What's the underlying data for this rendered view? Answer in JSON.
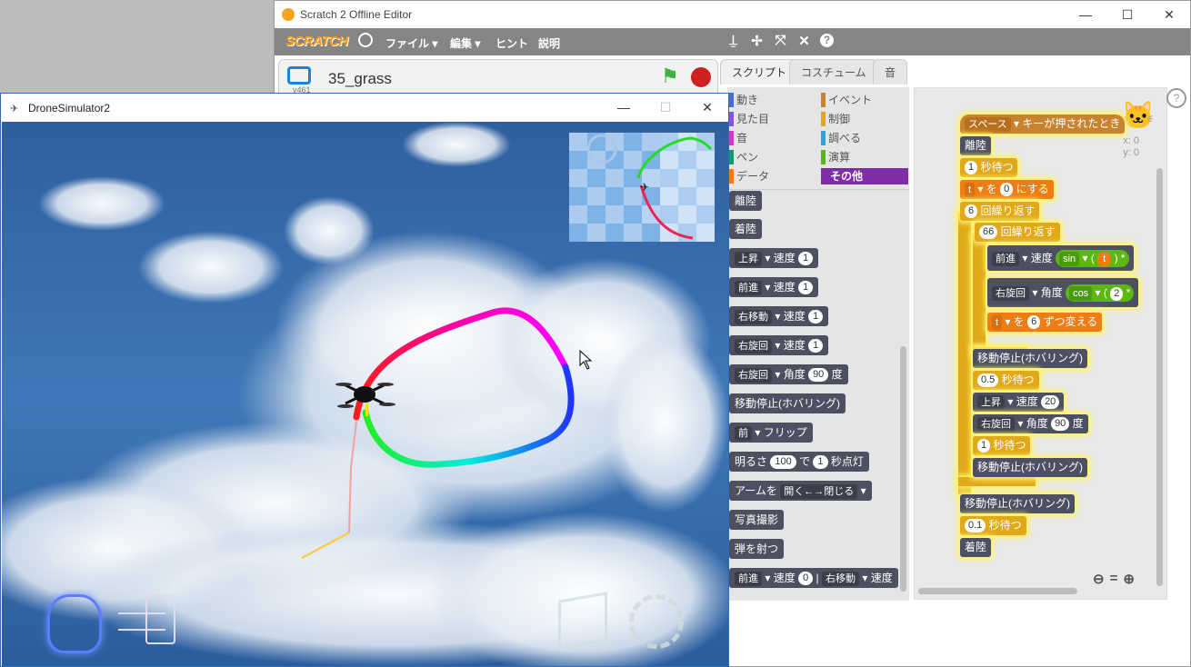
{
  "scratch": {
    "window_title": "Scratch 2 Offline Editor",
    "window_controls": {
      "minimize": "—",
      "maximize": "☐",
      "close": "✕"
    },
    "logo": "SCRATCH",
    "menu": [
      "ファイル ▾",
      "編集 ▾",
      "ヒント",
      "説明"
    ],
    "tool_icons": [
      "copy-tool-icon",
      "cut-tool-icon",
      "grow-tool-icon",
      "shrink-tool-icon",
      "help-tool-icon"
    ],
    "project_name": "35_grass",
    "version": "v461",
    "tabs": [
      "スクリプト",
      "コスチューム",
      "音"
    ],
    "categories_left": [
      {
        "label": "動き",
        "color": "#4a6cd4"
      },
      {
        "label": "見た目",
        "color": "#8a55d7"
      },
      {
        "label": "音",
        "color": "#bb42c3"
      },
      {
        "label": "ペン",
        "color": "#0e9a6c"
      },
      {
        "label": "データ",
        "color": "#ee7d16"
      }
    ],
    "categories_right": [
      {
        "label": "イベント",
        "color": "#c88330"
      },
      {
        "label": "制御",
        "color": "#e1a91a"
      },
      {
        "label": "調べる",
        "color": "#2ca5e2"
      },
      {
        "label": "演算",
        "color": "#5cb712"
      },
      {
        "label": "その他",
        "color": "#7f2ca7"
      }
    ],
    "palette_blocks": [
      {
        "text": "離陸"
      },
      {
        "text": "着陸"
      },
      {
        "dd": "上昇",
        "label": "速度",
        "num": "1"
      },
      {
        "dd": "前進",
        "label": "速度",
        "num": "1"
      },
      {
        "dd": "右移動",
        "label": "速度",
        "num": "1"
      },
      {
        "dd": "右旋回",
        "label": "速度",
        "num": "1"
      },
      {
        "dd": "右旋回",
        "label": "角度",
        "num": "90",
        "suffix": "度"
      },
      {
        "text": "移動停止(ホバリング)"
      },
      {
        "dd": "前",
        "label": "フリップ"
      },
      {
        "pre": "明るさ",
        "num": "100",
        "mid": "で",
        "num2": "1",
        "suffix": "秒点灯"
      },
      {
        "pre": "アームを",
        "dd": "開く←→閉じる"
      },
      {
        "text": "写真撮影"
      },
      {
        "text": "弾を射つ"
      },
      {
        "dd": "前進",
        "label": "速度",
        "num": "0",
        "mid": "| ",
        "dd2": "右移動",
        "label2": "速度"
      }
    ],
    "script": {
      "hat": {
        "dd": "スペース",
        "label": "キーが押されたとき"
      },
      "takeoff": "離陸",
      "wait1": {
        "num": "1",
        "label": "秒待つ"
      },
      "setvar": {
        "dd": "t",
        "label": "を",
        "num": "0",
        "suffix": "にする"
      },
      "repeat_outer": {
        "num": "6",
        "label": "回繰り返す"
      },
      "repeat_inner": {
        "num": "66",
        "label": "回繰り返す"
      },
      "forward": {
        "dd": "前進",
        "label": "速度",
        "fn": "sin",
        "var": "t",
        "tail": ") *"
      },
      "rotate": {
        "dd": "右旋回",
        "label": "角度",
        "fn": "cos",
        "num": "2",
        "tail": "*"
      },
      "change": {
        "dd": "t",
        "label": "を",
        "num": "6",
        "suffix": "ずつ変える"
      },
      "hover1": "移動停止(ホバリング)",
      "wait2": {
        "num": "0.5",
        "label": "秒待つ"
      },
      "up": {
        "dd": "上昇",
        "label": "速度",
        "num": "20"
      },
      "turn": {
        "dd": "右旋回",
        "label": "角度",
        "num": "90",
        "suffix": "度"
      },
      "wait3": {
        "num": "1",
        "label": "秒待つ"
      },
      "hover2": "移動停止(ホバリング)",
      "hover3": "移動停止(ホバリング)",
      "wait4": {
        "num": "0.1",
        "label": "秒待つ"
      },
      "land": "着陸"
    },
    "sprite_coords": {
      "x": "x: 0",
      "y": "y: 0"
    },
    "zoom_controls": [
      "zoom-out-icon",
      "zoom-reset-icon",
      "zoom-in-icon"
    ]
  },
  "drone": {
    "window_title": "DroneSimulator2",
    "window_controls": {
      "minimize": "—",
      "maximize": "☐",
      "close": "✕"
    },
    "bottom_icons": [
      "scratch-cat-icon",
      "drone-controller-icon",
      "cube-icon",
      "gear-icon"
    ]
  }
}
